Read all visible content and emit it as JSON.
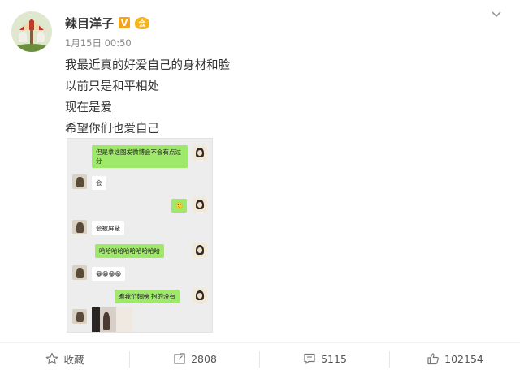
{
  "post": {
    "username": "辣目洋子",
    "vip_badge": "V",
    "level_badge": "会",
    "timestamp": "1月15日 00:50",
    "lines": [
      "我最近真的好爱自己的身材和脸",
      "以前只是和平相处",
      "现在是爱",
      "希望你们也爱自己"
    ]
  },
  "chat": {
    "messages": [
      {
        "side": "me",
        "text": "但是拿这图发微博会不会有点过分"
      },
      {
        "side": "other",
        "text": "会"
      },
      {
        "side": "me",
        "text": "🙂"
      },
      {
        "side": "other",
        "text": "会被屏蔽"
      },
      {
        "side": "me",
        "text": "哈哈哈哈哈哈哈哈哈哈"
      },
      {
        "side": "other",
        "text": "😁😁😁😁"
      },
      {
        "side": "me",
        "text": "瞧我个翅膀 抱的没有"
      }
    ]
  },
  "actions": {
    "favorite": "收藏",
    "repost": "2808",
    "comment": "5115",
    "like": "102154"
  },
  "colors": {
    "chat_green": "#9ee96a",
    "chat_bg": "#ededed",
    "vip": "#f7a21b"
  }
}
